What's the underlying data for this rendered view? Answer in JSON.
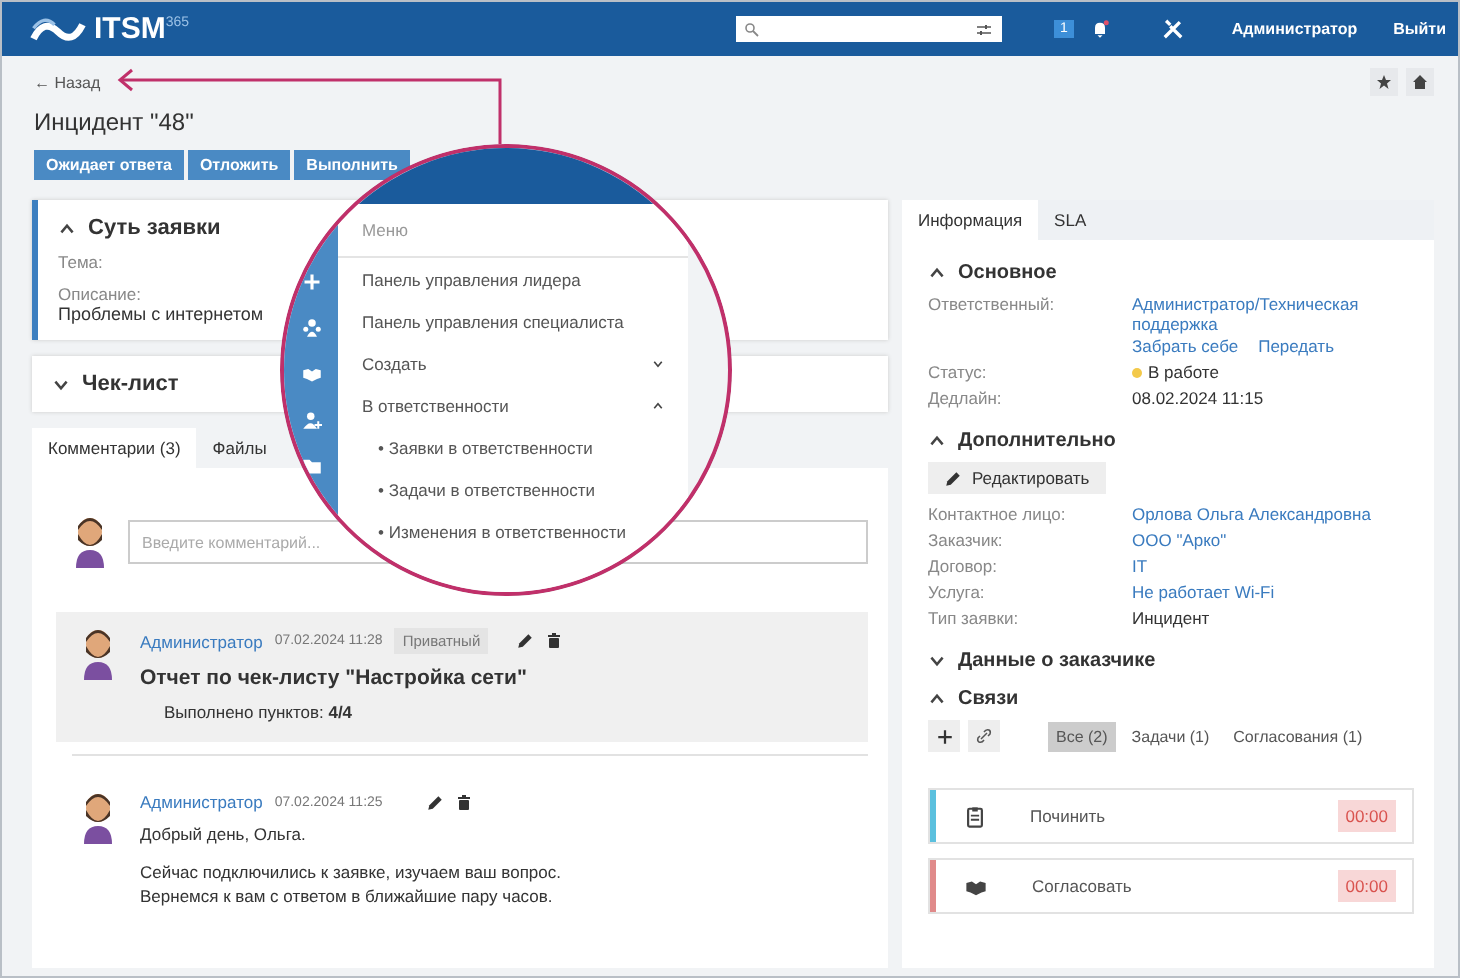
{
  "header": {
    "logo": "ITSM",
    "logo_sup": "365",
    "notification_count": "1",
    "user": "Администратор",
    "logout": "Выйти"
  },
  "page": {
    "back": "← Назад",
    "title": "Инцидент \"48\"",
    "actions": [
      "Ожидает ответа",
      "Отложить",
      "Выполнить"
    ]
  },
  "left": {
    "summary": {
      "title": "Суть заявки",
      "expanded": true,
      "fields": [
        {
          "label": "Тема:"
        },
        {
          "label": "Описание:",
          "value": "Проблемы с интернетом"
        }
      ]
    },
    "checklist": {
      "title": "Чек-лист",
      "expanded": false
    },
    "tabs": [
      {
        "label": "Комментарии (3)",
        "selected": true
      },
      {
        "label": "Файлы",
        "selected": false
      }
    ],
    "comment_input": {
      "placeholder": "Введите комментарий..."
    },
    "comments": [
      {
        "kind": "checklist",
        "author": "Администратор",
        "time": "07.02.2024 11:28",
        "badge": "Приватный",
        "title": "Отчет по чек-листу \"Настройка сети\"",
        "text": "Выполнено пунктов: **4/4**"
      },
      {
        "kind": "message",
        "author": "Администратор",
        "time": "07.02.2024 11:25",
        "paragraphs": [
          "Добрый день, Ольга.",
          "Сейчас подключились к заявке, изучаем ваш вопрос.",
          "Вернемся к вам с ответом в ближайшие пару часов."
        ]
      }
    ]
  },
  "right": {
    "tabs": [
      {
        "label": "Информация",
        "selected": true
      },
      {
        "label": "SLA",
        "selected": false
      }
    ],
    "main": {
      "title": "Основное",
      "expanded": true,
      "fields": [
        {
          "kind": "link",
          "label": "Ответственный:",
          "value": "Администратор/Техническая поддержка",
          "actions": [
            "Забрать себе",
            "Передать"
          ]
        },
        {
          "kind": "status",
          "label": "Статус:",
          "value": "В работе"
        },
        {
          "kind": "text",
          "label": "Дедлайн:",
          "value": "08.02.2024 11:15"
        }
      ]
    },
    "extra": {
      "title": "Дополнительно",
      "expanded": true,
      "edit_button": "Редактировать",
      "fields": [
        {
          "kind": "link",
          "label": "Контактное лицо:",
          "value": "Орлова Ольга Александровна"
        },
        {
          "kind": "link",
          "label": "Заказчик:",
          "value": "ООО \"Арко\""
        },
        {
          "kind": "link",
          "label": "Договор:",
          "value": "IT"
        },
        {
          "kind": "link",
          "label": "Услуга:",
          "value": "Не работает Wi-Fi"
        },
        {
          "kind": "text",
          "label": "Тип заявки:",
          "value": "Инцидент"
        }
      ]
    },
    "customer": {
      "title": "Данные о заказчике",
      "expanded": false
    },
    "relations": {
      "title": "Связи",
      "expanded": true,
      "filters": [
        {
          "label": "Все (2)",
          "selected": true
        },
        {
          "label": "Задачи (1)",
          "selected": false
        },
        {
          "label": "Согласования (1)",
          "selected": false
        }
      ],
      "items": [
        {
          "kind": "task",
          "title": "Починить",
          "timer": "00:00",
          "color": "#5bc0de"
        },
        {
          "kind": "approval",
          "title": "Согласовать",
          "timer": "00:00",
          "color": "#e08a8a"
        }
      ]
    }
  },
  "magnifier": {
    "title": "Меню",
    "items": [
      {
        "kind": "link",
        "label": "Панель управления лидера"
      },
      {
        "kind": "link",
        "label": "Панель управления специалиста"
      },
      {
        "kind": "group",
        "label": "Создать",
        "expanded": false
      },
      {
        "kind": "group",
        "label": "В ответственности",
        "expanded": true,
        "children": [
          {
            "label": "• Заявки в ответственности"
          },
          {
            "label": "• Задачи в ответственности"
          },
          {
            "label": "• Изменения в ответственности"
          }
        ]
      }
    ]
  }
}
